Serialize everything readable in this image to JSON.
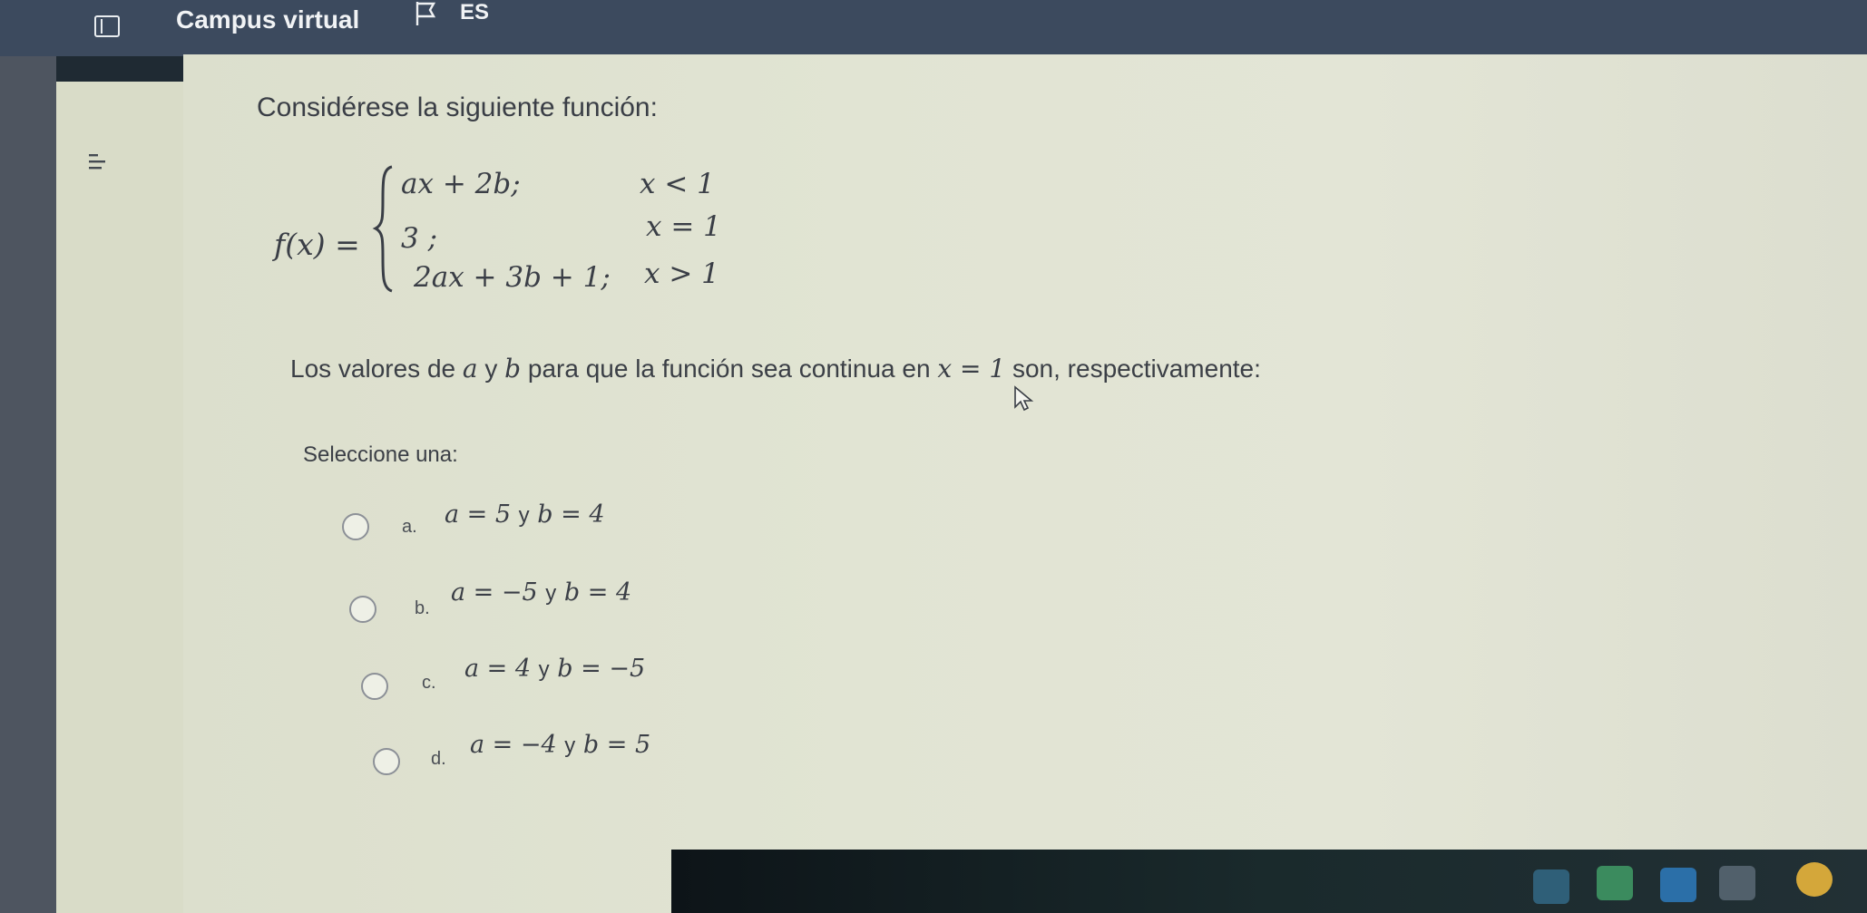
{
  "header": {
    "app_title": "Campus virtual",
    "language": "ES"
  },
  "icons": {
    "sidebar_toggle": "sidebar-toggle-icon",
    "flag": "flag-icon",
    "menu": "menu-icon",
    "cursor": "mouse-cursor-icon"
  },
  "question": {
    "intro": "Considérese la siguiente función:",
    "function_lhs": "f(x) =",
    "cases": [
      {
        "expr": "ax + 2b;",
        "cond": "x < 1"
      },
      {
        "expr": "3 ;",
        "cond": "x = 1"
      },
      {
        "expr": "2ax + 3b + 1;",
        "cond": "x > 1"
      }
    ],
    "prompt": {
      "part1": "Los valores de ",
      "var_a": "a",
      "part2": " y ",
      "var_b": "b",
      "part3": " para que la función sea continua en ",
      "point": "x = 1",
      "part4": " son, respectivamente:"
    },
    "select_label": "Seleccione una:",
    "options": [
      {
        "letter": "a.",
        "a_part": "a = 5",
        "y": "y",
        "b_part": "b = 4"
      },
      {
        "letter": "b.",
        "a_part": "a = −5",
        "y": "y",
        "b_part": "b = 4"
      },
      {
        "letter": "c.",
        "a_part": "a = 4",
        "y": "y",
        "b_part": "b = −5"
      },
      {
        "letter": "d.",
        "a_part": "a = −4",
        "y": "y",
        "b_part": "b = 5"
      }
    ]
  },
  "colors": {
    "topbar": "#3c4a5e",
    "page_background": "#e1e4d3",
    "text": "#3a3e46"
  }
}
